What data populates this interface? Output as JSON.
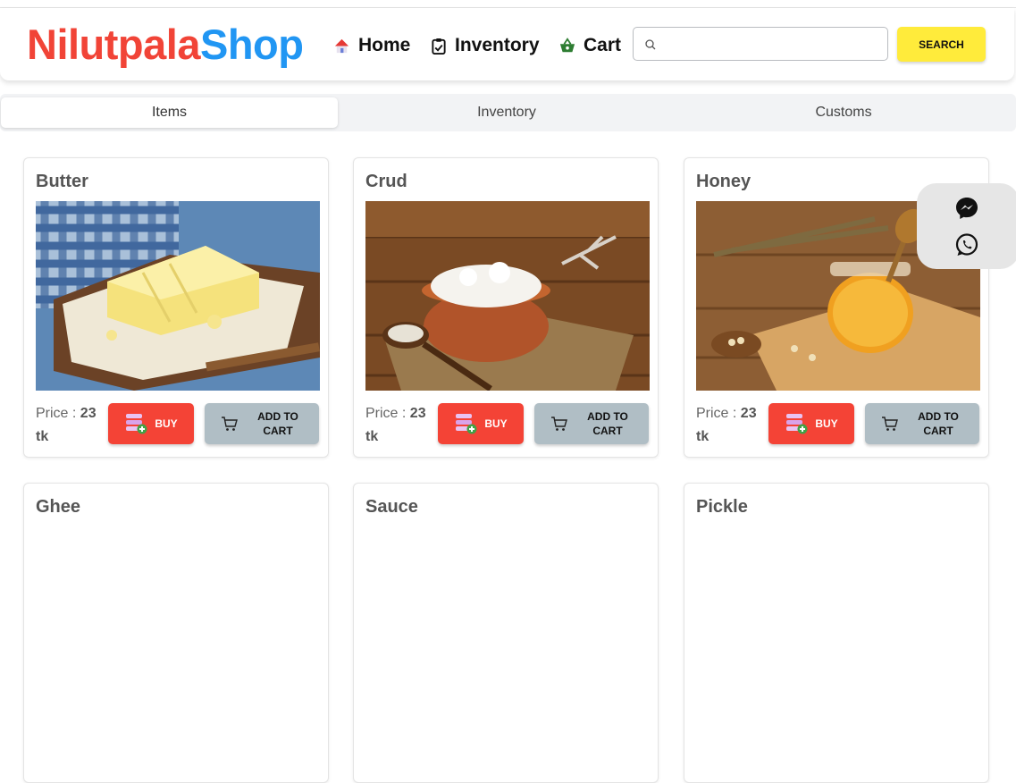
{
  "header": {
    "brand_part1": "Nilutpala",
    "brand_part2": "Shop",
    "nav": [
      {
        "label": "Home",
        "icon": "home-icon"
      },
      {
        "label": "Inventory",
        "icon": "clipboard-icon"
      },
      {
        "label": "Cart",
        "icon": "basket-icon"
      }
    ],
    "search": {
      "placeholder": "",
      "value": "",
      "button_label": "SEARCH"
    }
  },
  "tabs": [
    {
      "label": "Items",
      "active": true
    },
    {
      "label": "Inventory",
      "active": false
    },
    {
      "label": "Customs",
      "active": false
    }
  ],
  "products": [
    {
      "name": "Butter",
      "price_label": "Price :",
      "price_value": "23",
      "currency": "tk",
      "buy_label": "BUY",
      "cart_label": "ADD TO CART"
    },
    {
      "name": "Crud",
      "price_label": "Price :",
      "price_value": "23",
      "currency": "tk",
      "buy_label": "BUY",
      "cart_label": "ADD TO CART"
    },
    {
      "name": "Honey",
      "price_label": "Price :",
      "price_value": "23",
      "currency": "tk",
      "buy_label": "BUY",
      "cart_label": "ADD TO CART"
    },
    {
      "name": "Ghee"
    },
    {
      "name": "Sauce"
    },
    {
      "name": "Pickle"
    }
  ],
  "floating_contact": [
    "messenger-icon",
    "whatsapp-icon"
  ],
  "colors": {
    "brand_red": "#f14437",
    "brand_blue": "#2196f3",
    "search_button": "#ffeb3b",
    "buy_button": "#f44336",
    "cart_button": "#b0bec5"
  }
}
